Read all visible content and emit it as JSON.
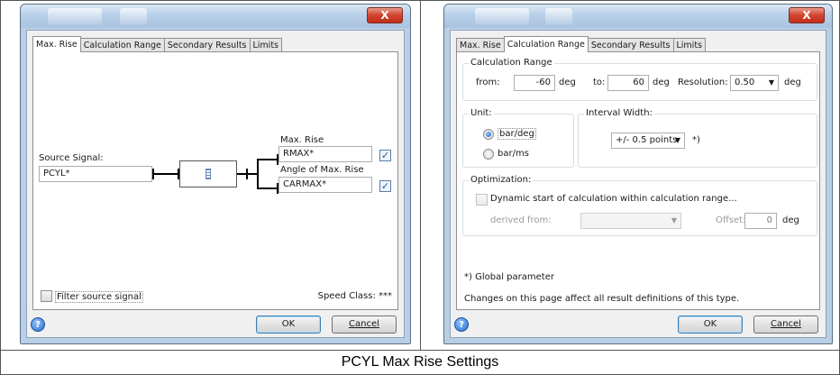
{
  "caption": "PCYL Max Rise Settings",
  "dialog_left": {
    "tabs": [
      {
        "label": "Max. Rise",
        "active": true
      },
      {
        "label": "Calculation Range",
        "active": false
      },
      {
        "label": "Secondary Results",
        "active": false
      },
      {
        "label": "Limits",
        "active": false
      }
    ],
    "source_signal_label": "Source Signal:",
    "source_signal_value": "PCYL*",
    "max_rise_label": "Max. Rise",
    "max_rise_value": "RMAX*",
    "angle_label": "Angle of Max. Rise",
    "angle_value": "CARMAX*",
    "filter_label": "Filter source signal",
    "speed_class": "Speed Class: ***",
    "ok": "OK",
    "cancel": "Cancel",
    "close": "X"
  },
  "dialog_right": {
    "tabs": [
      {
        "label": "Max. Rise",
        "active": false
      },
      {
        "label": "Calculation Range",
        "active": true
      },
      {
        "label": "Secondary Results",
        "active": false
      },
      {
        "label": "Limits",
        "active": false
      }
    ],
    "calc_range": {
      "title": "Calculation Range",
      "from_label": "from:",
      "from_value": "-60",
      "from_unit": "deg",
      "to_label": "to:",
      "to_value": "60",
      "to_unit": "deg",
      "resolution_label": "Resolution:",
      "resolution_value": "0.50",
      "resolution_unit": "deg"
    },
    "unit": {
      "title": "Unit:",
      "options": [
        "bar/deg",
        "bar/ms"
      ],
      "selected": "bar/deg"
    },
    "interval": {
      "title": "Interval Width:",
      "value": "+/- 0.5 points",
      "note": "*)"
    },
    "optimization": {
      "title": "Optimization:",
      "checkbox_label": "Dynamic start of calculation within calculation range...",
      "derived_label": "derived from:",
      "derived_value": "",
      "offset_label": "Offset:",
      "offset_value": "0",
      "offset_unit": "deg"
    },
    "global_note": "*) Global parameter",
    "changes_note": "Changes on this page affect all result definitions of this type.",
    "ok": "OK",
    "cancel": "Cancel",
    "close": "X"
  }
}
